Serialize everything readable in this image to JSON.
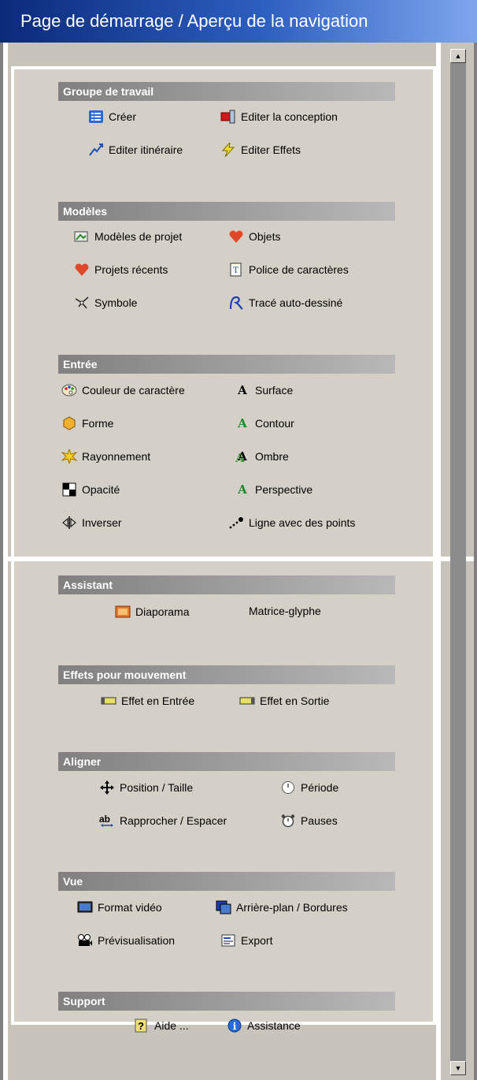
{
  "title": "Page de démarrage / Aperçu de la navigation",
  "sections": {
    "groupe": {
      "header": "Groupe de travail",
      "creer": "Créer",
      "editer_conception": "Editer la conception",
      "editer_itineraire": "Editer itinéraire",
      "editer_effets": "Editer Effets"
    },
    "modeles": {
      "header": "Modèles",
      "modeles_projet": "Modèles de projet",
      "objets": "Objets",
      "projets_recents": "Projets récents",
      "police": "Police de caractères",
      "symbole": "Symbole",
      "trace": "Tracé auto-dessiné"
    },
    "entree": {
      "header": "Entrée",
      "couleur": "Couleur de caractère",
      "surface": "Surface",
      "forme": "Forme",
      "contour": "Contour",
      "rayonnement": "Rayonnement",
      "ombre": "Ombre",
      "opacite": "Opacité",
      "perspective": "Perspective",
      "inverser": "Inverser",
      "ligne": "Ligne avec des points"
    },
    "assistant": {
      "header": "Assistant",
      "diaporama": "Diaporama",
      "matrice": "Matrice-glyphe"
    },
    "mouvement": {
      "header": "Effets pour mouvement",
      "entree": "Effet en Entrée",
      "sortie": "Effet en Sortie"
    },
    "aligner": {
      "header": "Aligner",
      "position": "Position / Taille",
      "periode": "Période",
      "rapprocher": "Rapprocher / Espacer",
      "pauses": "Pauses"
    },
    "vue": {
      "header": "Vue",
      "format": "Format vidéo",
      "arriere": "Arrière-plan / Bordures",
      "previsualisation": "Prévisualisation",
      "export": "Export"
    },
    "support": {
      "header": "Support",
      "aide": "Aide ...",
      "assistance": "Assistance"
    }
  },
  "colors": {
    "title_start": "#0b2a7a",
    "title_end": "#7ea6ec",
    "panel_bg": "#d4d0c8",
    "header_bg": "#808080"
  }
}
